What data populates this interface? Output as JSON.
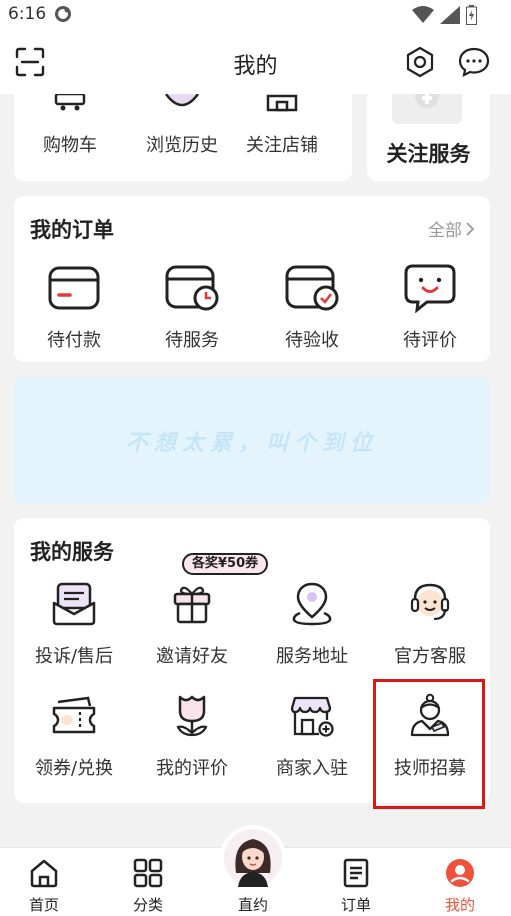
{
  "status": {
    "time": "6:16"
  },
  "header": {
    "title": "我的"
  },
  "top_card": {
    "items": [
      {
        "label": "购物车",
        "icon": "shopping-cart-icon"
      },
      {
        "label": "浏览历史",
        "icon": "history-icon"
      },
      {
        "label": "关注店铺",
        "icon": "store-icon"
      }
    ],
    "follow_service_label": "关注服务"
  },
  "orders": {
    "title": "我的订单",
    "all_label": "全部",
    "items": [
      {
        "label": "待付款",
        "icon": "card-payment-icon"
      },
      {
        "label": "待服务",
        "icon": "card-clock-icon"
      },
      {
        "label": "待验收",
        "icon": "card-check-icon"
      },
      {
        "label": "待评价",
        "icon": "smile-chat-icon"
      }
    ]
  },
  "banner": {
    "text": "不想太累，叫个到位"
  },
  "services": {
    "title": "我的服务",
    "badge": "各奖¥50券",
    "items": [
      {
        "label": "投诉/售后",
        "icon": "mail-icon"
      },
      {
        "label": "邀请好友",
        "icon": "gift-icon"
      },
      {
        "label": "服务地址",
        "icon": "location-pin-icon"
      },
      {
        "label": "官方客服",
        "icon": "headset-icon"
      },
      {
        "label": "领券/兑换",
        "icon": "coupon-icon"
      },
      {
        "label": "我的评价",
        "icon": "tulip-icon"
      },
      {
        "label": "商家入驻",
        "icon": "shop-add-icon"
      },
      {
        "label": "技师招募",
        "icon": "technician-icon"
      }
    ]
  },
  "bottom_nav": {
    "items": [
      {
        "label": "首页",
        "icon": "home-icon"
      },
      {
        "label": "分类",
        "icon": "grid-icon"
      },
      {
        "label": "直约",
        "icon": "avatar-icon"
      },
      {
        "label": "订单",
        "icon": "document-icon"
      },
      {
        "label": "我的",
        "icon": "profile-icon"
      }
    ],
    "active": "我的"
  },
  "colors": {
    "accent": "#f0513c",
    "highlight": "#e01515",
    "banner": "#e4f4fd"
  }
}
